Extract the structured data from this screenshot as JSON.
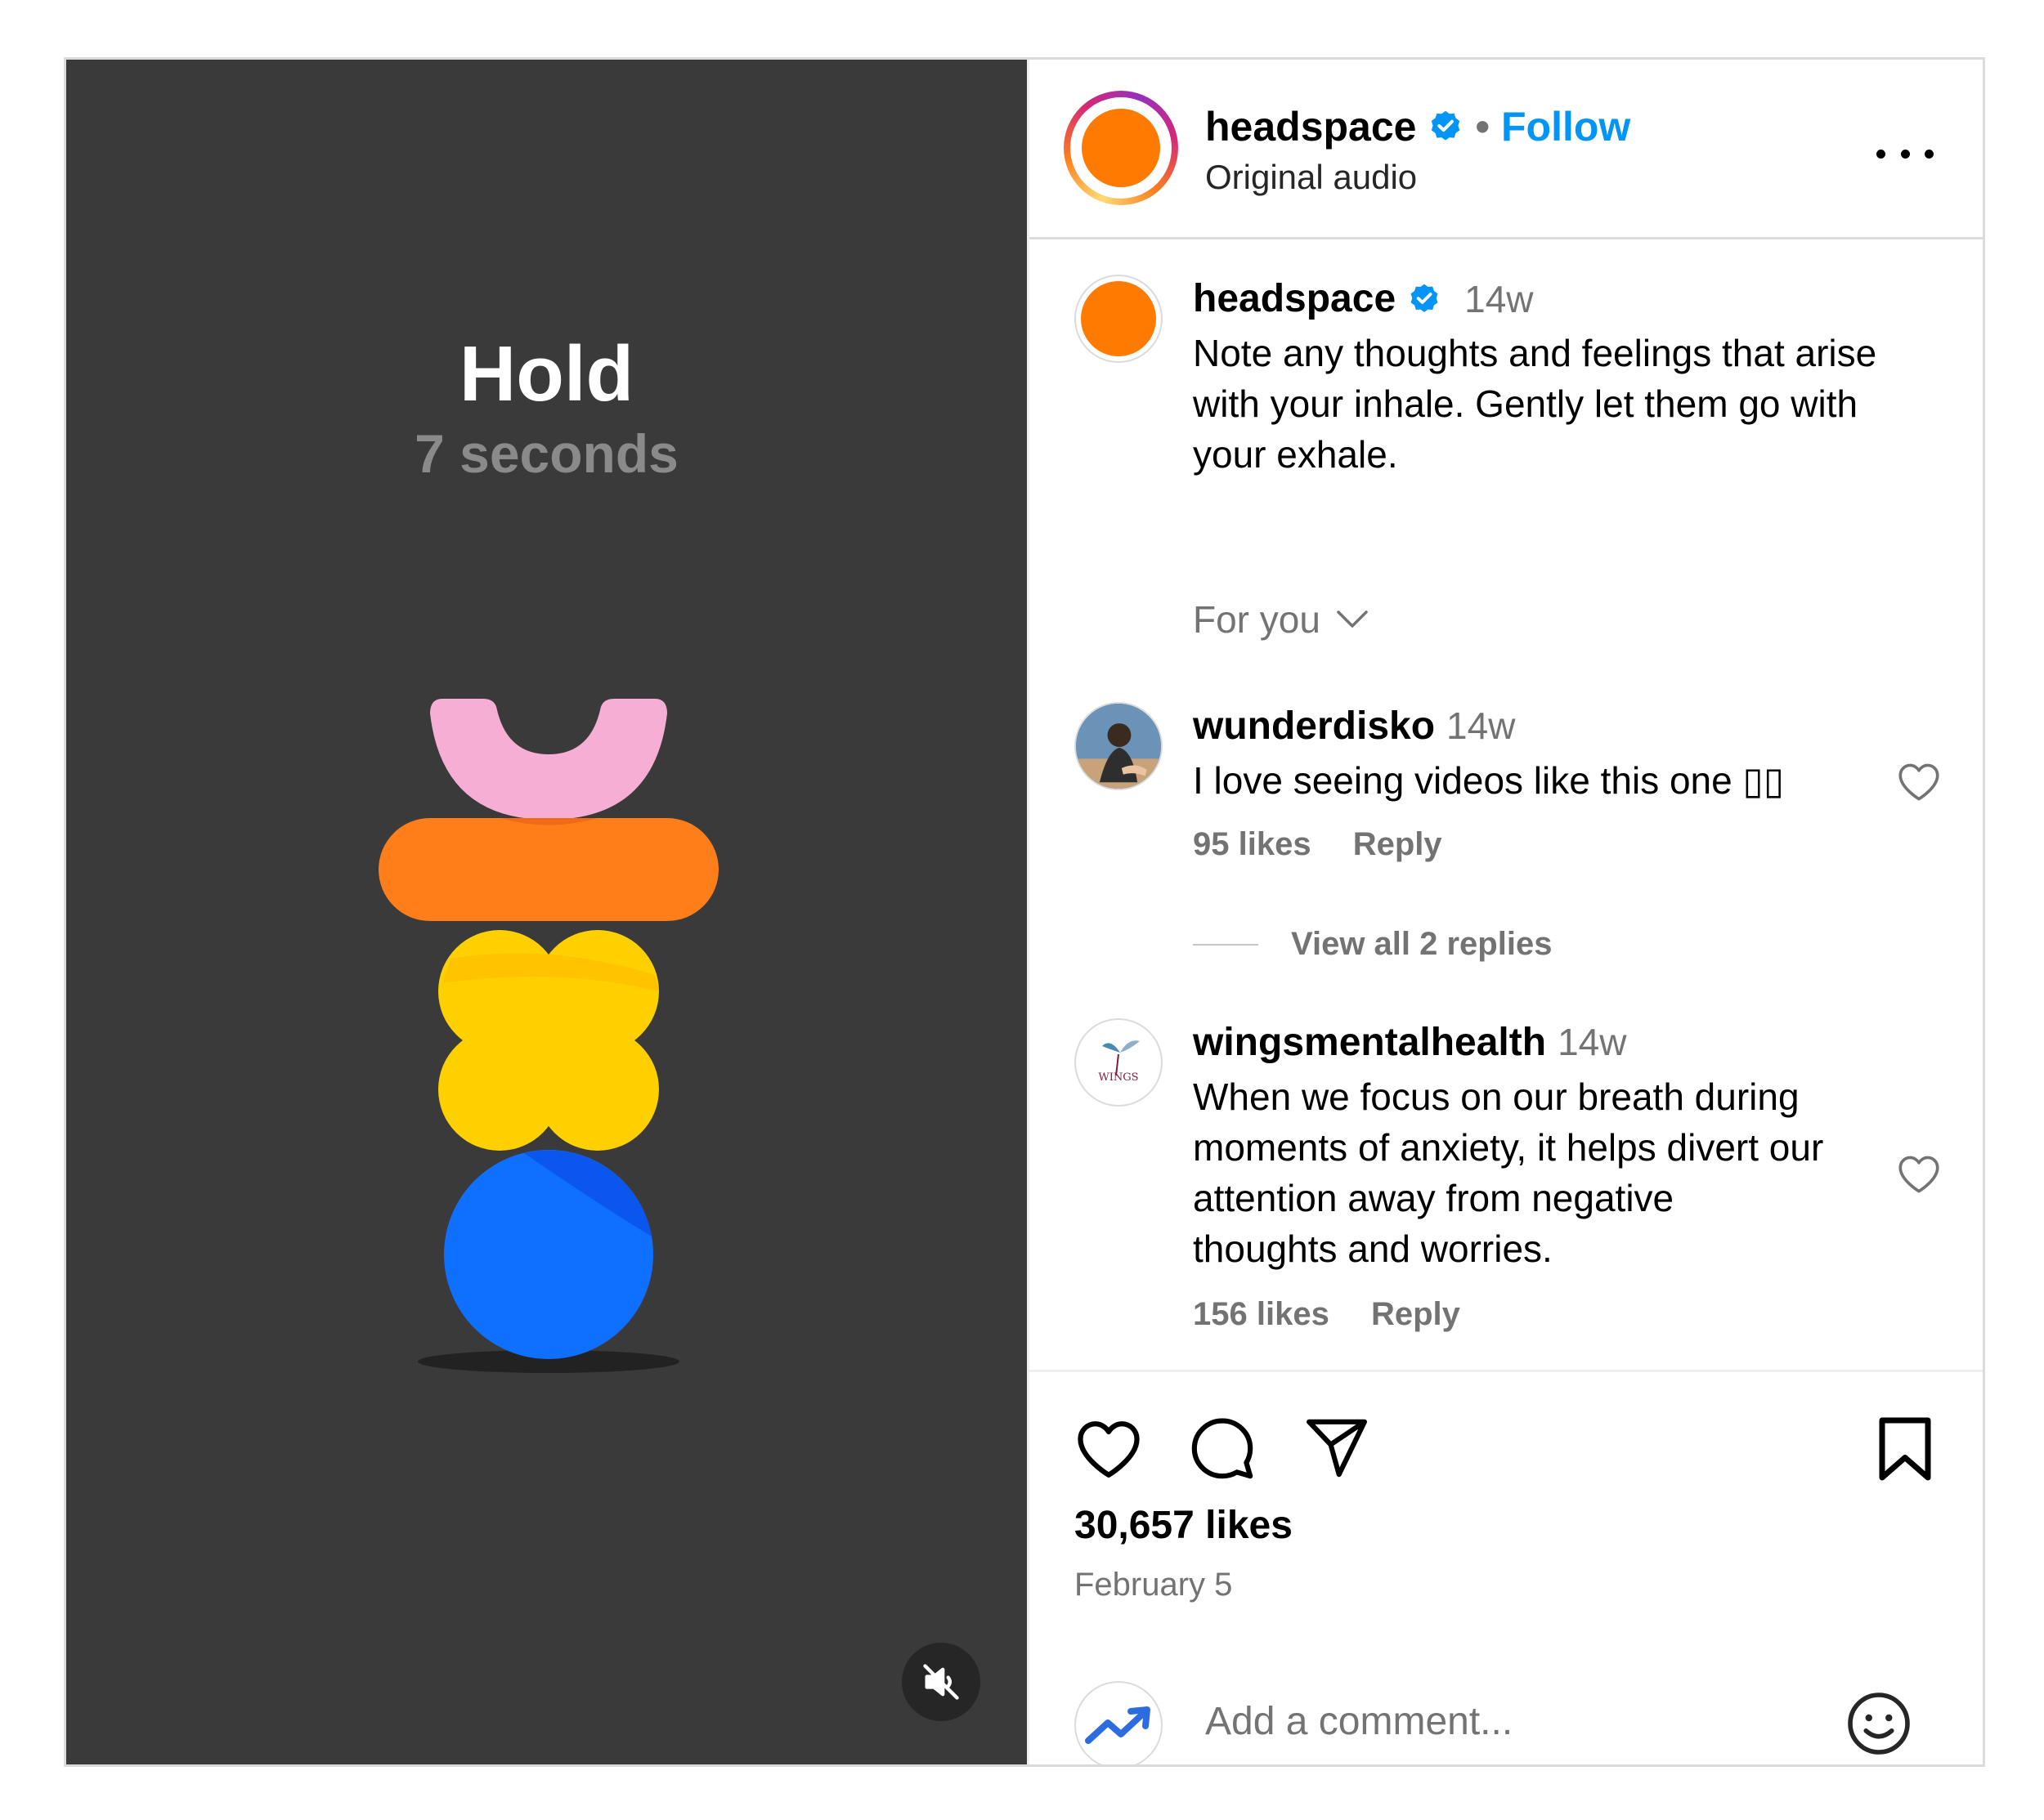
{
  "media": {
    "title": "Hold",
    "subtitle": "7 seconds",
    "mute_icon": "speaker-muted-icon"
  },
  "header": {
    "username": "headspace",
    "separator": "•",
    "follow_label": "Follow",
    "audio_label": "Original audio",
    "more_icon": "more-options-icon"
  },
  "caption": {
    "username": "headspace",
    "time": "14w",
    "text_lines": [
      "Note any thoughts and feelings that arise",
      "with your inhale. Gently let them go with",
      "your exhale."
    ]
  },
  "filter": {
    "label": "For you"
  },
  "comments": [
    {
      "username": "wunderdisko",
      "time": "14w",
      "text_lines": [
        "I love seeing videos like this one ▯▯"
      ],
      "likes": "95 likes",
      "reply": "Reply",
      "view_replies": "View all 2 replies"
    },
    {
      "username": "wingsmentalhealth",
      "time": "14w",
      "text_lines": [
        "When we focus on our breath during",
        "moments of anxiety, it helps divert our",
        "attention away from negative",
        "thoughts and worries."
      ],
      "likes": "156 likes",
      "reply": "Reply",
      "avatar_text": "WINGS"
    }
  ],
  "actions": {
    "likes": "30,657 likes",
    "date": "February 5"
  },
  "add_comment": {
    "placeholder": "Add a comment..."
  },
  "colors": {
    "media_bg": "#3a3a3a",
    "accent_blue": "#0095f6",
    "headspace_orange": "#ff7a00",
    "pink": "#f7aed5",
    "orange": "#ff7e1a",
    "yellow": "#ffd000",
    "blue": "#0f6fff"
  }
}
